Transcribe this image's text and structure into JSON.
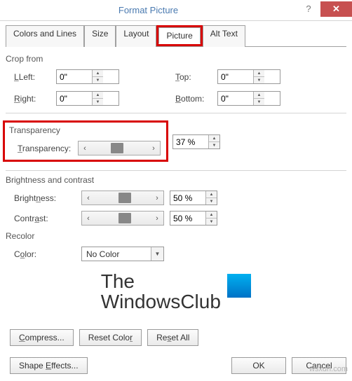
{
  "window": {
    "title": "Format Picture"
  },
  "tabs": {
    "colors": "Colors and Lines",
    "size": "Size",
    "layout": "Layout",
    "picture": "Picture",
    "alt": "Alt Text"
  },
  "sections": {
    "crop": "Crop from",
    "transparency": "Transparency",
    "brightness": "Brightness and contrast",
    "recolor": "Recolor"
  },
  "crop": {
    "left_label": "Left:",
    "right_label": "Right:",
    "top_label": "Top:",
    "bottom_label": "Bottom:",
    "left": "0\"",
    "right": "0\"",
    "top": "0\"",
    "bottom": "0\""
  },
  "transparency": {
    "label": "Transparency:",
    "value": "37 %"
  },
  "brightness": {
    "b_label": "Brightness:",
    "c_label": "Contrast:",
    "brightness": "50 %",
    "contrast": "50 %"
  },
  "recolor": {
    "label": "Color:",
    "value": "No Color"
  },
  "logo": {
    "line1": "The",
    "line2": "WindowsClub"
  },
  "buttons": {
    "compress": "Compress...",
    "reset_color": "Reset Color",
    "reset_all": "Reset All",
    "shape_effects": "Shape Effects...",
    "ok": "OK",
    "cancel": "Cancel"
  },
  "watermark": "wsxdn.com"
}
